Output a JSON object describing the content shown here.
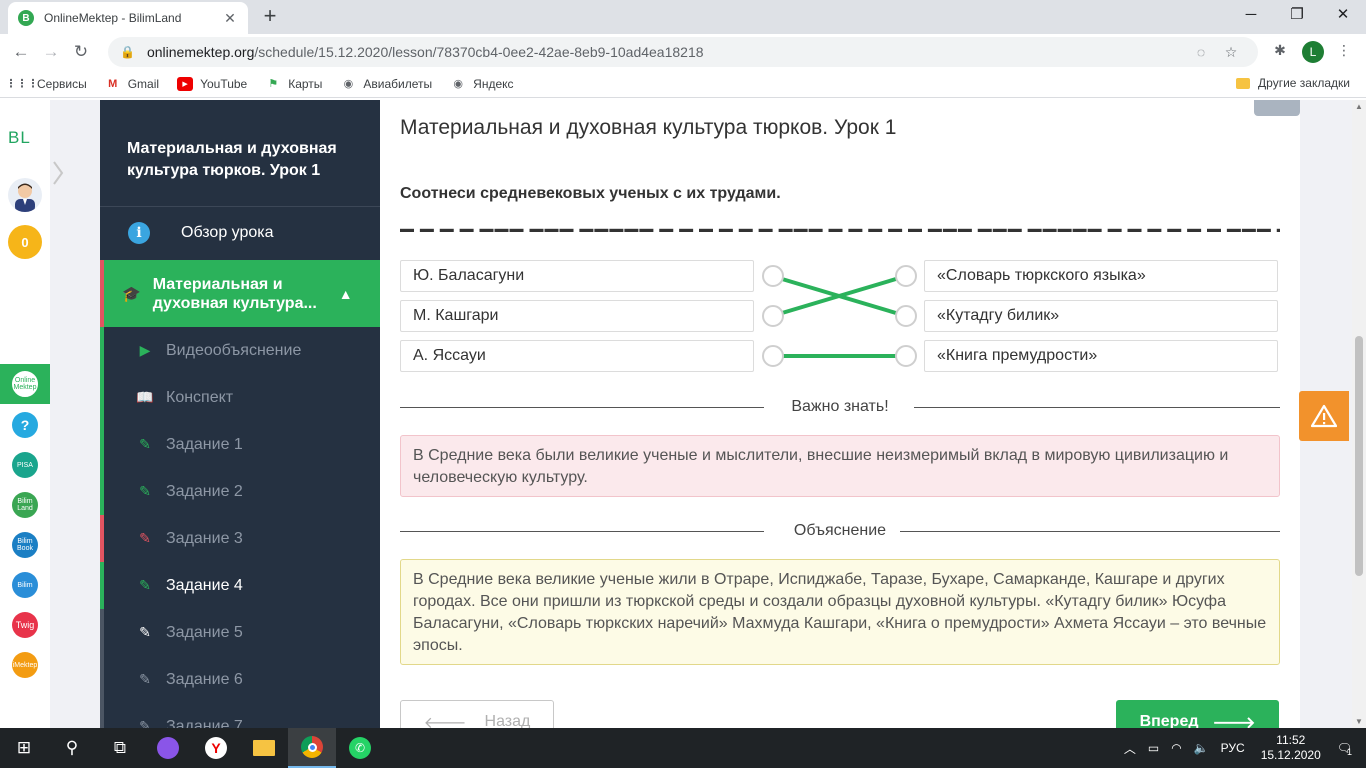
{
  "browser": {
    "tab_title": "OnlineMektep - BilimLand",
    "tab_favicon_letter": "B",
    "url_host": "onlinemektep.org",
    "url_path": "/schedule/15.12.2020/lesson/78370cb4-0ee2-42ae-8eb9-10ad4ea18218",
    "profile_letter": "L",
    "bookmarks": [
      {
        "label": "Сервисы",
        "icon": "apps-grid-icon"
      },
      {
        "label": "Gmail",
        "icon": "gmail-icon"
      },
      {
        "label": "YouTube",
        "icon": "youtube-icon"
      },
      {
        "label": "Карты",
        "icon": "maps-icon"
      },
      {
        "label": "Авиабилеты",
        "icon": "globe-icon"
      },
      {
        "label": "Яндекс",
        "icon": "globe-icon"
      }
    ],
    "other_bookmarks": "Другие закладки"
  },
  "rail": {
    "logo": "BL",
    "coins": "0",
    "help": "?",
    "apps": [
      {
        "label": "Online Mektep",
        "color": "#2bb25b"
      },
      {
        "label": "?",
        "color": "#26a9e0"
      },
      {
        "label": "PISA",
        "color": "#1aa58d"
      },
      {
        "label": "Bilim Land",
        "color": "#3aa653"
      },
      {
        "label": "Bilim Book",
        "color": "#1b7fc4"
      },
      {
        "label": "Bilim",
        "color": "#2a8ed8"
      },
      {
        "label": "Twig",
        "color": "#e8334a"
      },
      {
        "label": "iMektep",
        "color": "#f39c12"
      }
    ]
  },
  "sidebar": {
    "title": "Материальная и духовная культура тюрков. Урок 1",
    "overview": "Обзор урока",
    "active_section": "Материальная и духовная культура...",
    "items": [
      {
        "label": "Видеообъяснение",
        "icon": "play-icon",
        "state": "done"
      },
      {
        "label": "Конспект",
        "icon": "book-icon",
        "state": "done"
      },
      {
        "label": "Задание 1",
        "icon": "edit-icon",
        "state": "done"
      },
      {
        "label": "Задание 2",
        "icon": "edit-icon",
        "state": "done"
      },
      {
        "label": "Задание 3",
        "icon": "edit-icon",
        "state": "wrong"
      },
      {
        "label": "Задание 4",
        "icon": "edit-icon",
        "state": "current"
      },
      {
        "label": "Задание 5",
        "icon": "edit-icon",
        "state": "todo"
      },
      {
        "label": "Задание 6",
        "icon": "edit-icon",
        "state": "todo"
      },
      {
        "label": "Задание 7",
        "icon": "edit-icon",
        "state": "todo"
      }
    ]
  },
  "main": {
    "lesson_title": "Материальная и духовная культура тюрков. Урок 1",
    "question": "Соотнеси средневековых ученых с их трудами.",
    "left_items": [
      "Ю. Баласагуни",
      "М. Кашгари",
      "А. Яссауи"
    ],
    "right_items": [
      "«Словарь тюркского языка»",
      "«Кутадгу билик»",
      "«Книга премудрости»"
    ],
    "connections": [
      [
        0,
        1
      ],
      [
        1,
        0
      ],
      [
        2,
        2
      ]
    ],
    "important_heading": "Важно знать!",
    "important_text": "В Средние века были великие ученые и мыслители, внесшие неизмеримый вклад в мировую цивилизацию и человеческую культуру.",
    "explanation_heading": "Объяснение",
    "explanation_text": "В Средние века великие ученые жили в Отраре, Испиджабе, Таразе, Бухаре, Самарканде, Кашгаре и других городах. Все они пришли из тюркской среды и создали образцы духовной культуры. «Кутадгу билик» Юсуфа Баласагуни, «Словарь тюркских наречий» Махмуда Кашгари, «Книга о премудрости» Ахмета Яссауи – это вечные эпосы.",
    "back_label": "Назад",
    "next_label": "Вперед",
    "accent_color": "#2bb25b",
    "error_color": "#e25461"
  },
  "taskbar": {
    "lang": "РУС",
    "time": "11:52",
    "date": "15.12.2020",
    "notifications": "1"
  }
}
